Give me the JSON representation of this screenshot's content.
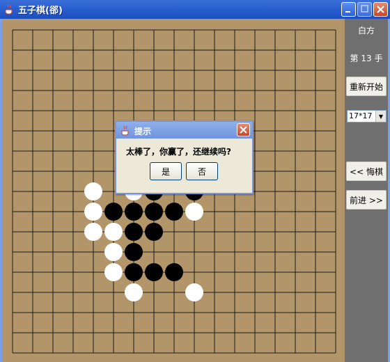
{
  "window": {
    "title": "五子棋(郤)"
  },
  "side": {
    "turn_label": "白方",
    "move_label": "第 13 手",
    "restart_label": "重新开始",
    "size_select": "17*17",
    "undo_label": "<< 悔棋",
    "forward_label": "前进 >>"
  },
  "dialog": {
    "title": "提示",
    "message": "太棒了，你赢了，还继续吗?",
    "yes_label": "是",
    "no_label": "否"
  },
  "board": {
    "size": 17,
    "black_stones": [
      [
        5,
        9
      ],
      [
        6,
        9
      ],
      [
        7,
        9
      ],
      [
        8,
        9
      ],
      [
        6,
        10
      ],
      [
        7,
        10
      ],
      [
        6,
        11
      ],
      [
        6,
        12
      ],
      [
        7,
        12
      ],
      [
        8,
        12
      ],
      [
        7,
        8
      ],
      [
        9,
        8
      ]
    ],
    "white_stones": [
      [
        4,
        8
      ],
      [
        4,
        9
      ],
      [
        4,
        10
      ],
      [
        5,
        10
      ],
      [
        5,
        11
      ],
      [
        5,
        12
      ],
      [
        6,
        13
      ],
      [
        9,
        13
      ],
      [
        9,
        9
      ],
      [
        6,
        8
      ]
    ]
  },
  "colors": {
    "board": "#b3956a",
    "line": "#1a1a1a",
    "black_stone": "#000000",
    "white_stone": "#ffffff"
  }
}
